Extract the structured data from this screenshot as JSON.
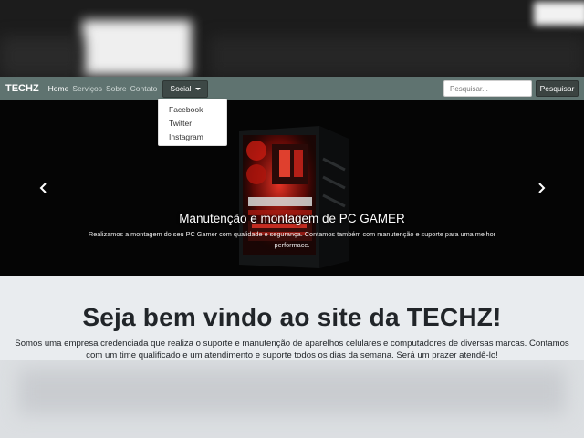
{
  "navbar": {
    "brand": "TECHZ",
    "links": [
      {
        "label": "Home",
        "active": true
      },
      {
        "label": "Serviços",
        "active": false
      },
      {
        "label": "Sobre",
        "active": false
      },
      {
        "label": "Contato",
        "active": false
      }
    ],
    "dropdown": {
      "label": "Social",
      "items": [
        "Facebook",
        "Twitter",
        "Instagram"
      ]
    },
    "search": {
      "placeholder": "Pesquisar...",
      "value": "",
      "button_label": "Pesquisar"
    }
  },
  "carousel": {
    "caption_title": "Manutenção e montagem de PC GAMER",
    "caption_text": "Realizamos a montagem do seu PC Gamer com qualidade e segurança. Contamos também com manutenção e suporte para uma melhor performace.",
    "prev_icon": "chevron-left-icon",
    "next_icon": "chevron-right-icon"
  },
  "jumbotron": {
    "title": "Seja bem vindo ao site da TECHZ!",
    "text": "Somos uma empresa credenciada que realiza o suporte e manutenção de aparelhos celulares e computadores de diversas marcas. Contamos com um time qualificado e um atendimento e suporte todos os dias da semana. Será um prazer atendê-lo!"
  },
  "colors": {
    "navbar_bg": "#5f7370",
    "carousel_bg": "#050505",
    "jumbotron_bg": "#e9ecef",
    "accent_red": "#e0201a"
  }
}
